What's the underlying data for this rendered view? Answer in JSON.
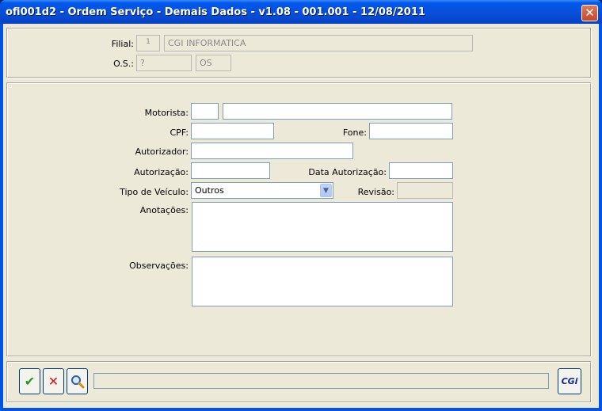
{
  "window": {
    "title": "ofi001d2 - Ordem Serviço - Demais Dados - v1.08 - 001.001 - 12/08/2011",
    "close": "✕"
  },
  "header": {
    "filial_label": "Filial:",
    "filial_code": "1",
    "filial_name": "CGI INFORMATICA",
    "os_label": "O.S.:",
    "os_value": "?",
    "os_type": "OS"
  },
  "form": {
    "motorista_label": "Motorista:",
    "motorista_code": "",
    "motorista_name": "",
    "cpf_label": "CPF:",
    "cpf_value": "",
    "fone_label": "Fone:",
    "fone_value": "",
    "autorizador_label": "Autorizador:",
    "autorizador_value": "",
    "autorizacao_label": "Autorização:",
    "autorizacao_value": "",
    "data_autorizacao_label": "Data Autorização:",
    "data_autorizacao_value": "",
    "tipo_veiculo_label": "Tipo de Veículo:",
    "tipo_veiculo_value": "Outros",
    "revisao_label": "Revisão:",
    "revisao_value": "",
    "anotacoes_label": "Anotações:",
    "anotacoes_value": "",
    "observacoes_label": "Observações:",
    "observacoes_value": ""
  },
  "toolbar": {
    "confirm_icon": "✔",
    "cancel_icon": "✕",
    "search_icon": "magnifier",
    "logo_text": "CGi",
    "colors": {
      "confirm": "#1e9a1e",
      "cancel": "#d01818",
      "logo": "#0a2a9a"
    }
  }
}
